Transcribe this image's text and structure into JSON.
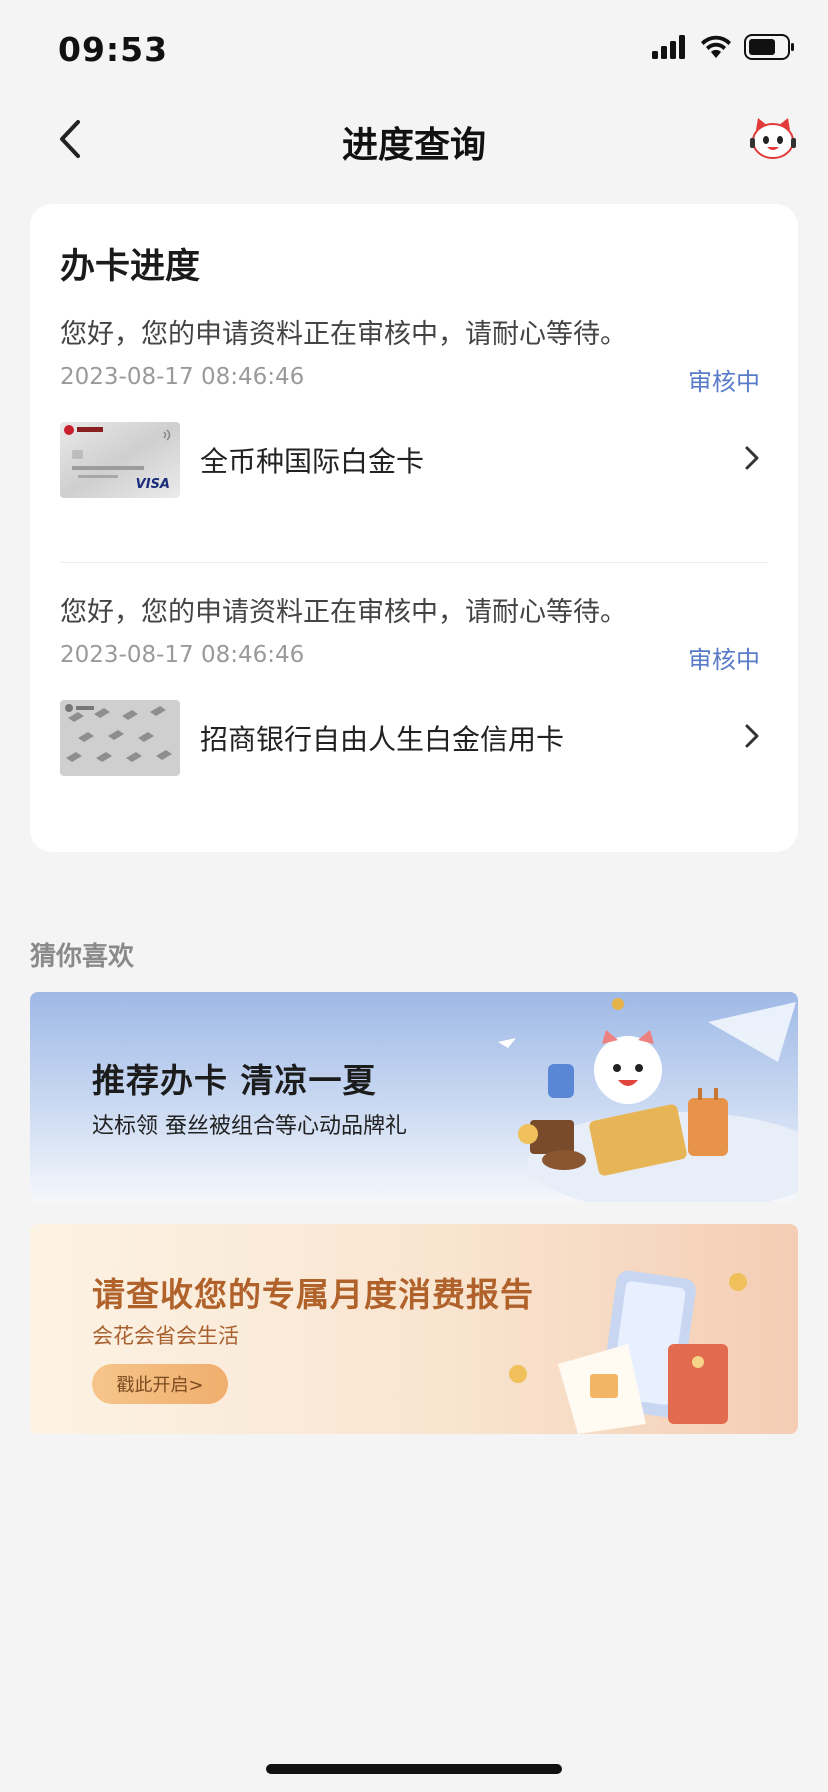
{
  "status_bar": {
    "time": "09:53"
  },
  "nav": {
    "title": "进度查询"
  },
  "progress_card": {
    "title": "办卡进度",
    "applications": [
      {
        "message": "您好，您的申请资料正在审核中，请耐心等待。",
        "timestamp": "2023-08-17 08:46:46",
        "status": "审核中",
        "card_name": "全币种国际白金卡",
        "card_brand_text": "VISA"
      },
      {
        "message": "您好，您的申请资料正在审核中，请耐心等待。",
        "timestamp": "2023-08-17 08:46:46",
        "status": "审核中",
        "card_name": "招商银行自由人生白金信用卡"
      }
    ]
  },
  "recommend": {
    "label": "猜你喜欢",
    "banners": [
      {
        "title": "推荐办卡 清凉一夏",
        "subtitle": "达标领 蚕丝被组合等心动品牌礼"
      },
      {
        "title": "请查收您的专属月度消费报告",
        "subtitle": "会花会省会生活",
        "button": "戳此开启>"
      }
    ]
  },
  "colors": {
    "status_accent": "#5a7bc7",
    "background": "#f4f4f4",
    "banner2_title": "#b0622a"
  }
}
